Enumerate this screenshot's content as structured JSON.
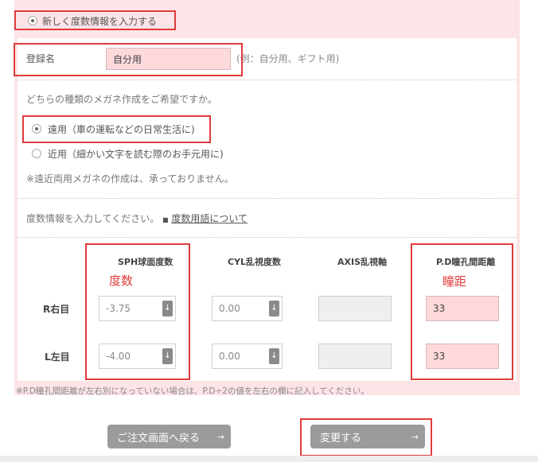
{
  "new_entry": {
    "label": "新しく度数情報を入力する",
    "selected": true
  },
  "registration": {
    "label": "登録名",
    "value": "自分用",
    "hint": "(例：自分用、ギフト用)"
  },
  "glasses_type": {
    "question": "どちらの種類のメガネ作成をご希望ですか。",
    "options": [
      {
        "label": "遠用（車の運転などの日常生活に)",
        "selected": true
      },
      {
        "label": "近用（細かい文字を読む際のお手元用に)",
        "selected": false
      }
    ],
    "note": "※遠近両用メガネの作成は、承っておりません。"
  },
  "prescription": {
    "intro": "度数情報を入力してください。",
    "terms_link": "度数用語について",
    "columns": [
      "SPH球面度数",
      "CYL乱視度数",
      "AXIS乱視軸",
      "P.D瞳孔間距離"
    ],
    "annotations": {
      "sph": "度数",
      "pd": "瞳距"
    },
    "rows": [
      {
        "label": "R右目",
        "sph": "-3.75",
        "cyl": "0.00",
        "axis": "",
        "pd": "33"
      },
      {
        "label": "L左目",
        "sph": "-4.00",
        "cyl": "0.00",
        "axis": "",
        "pd": "33"
      }
    ],
    "stepper_glyph": "↓",
    "footnote": "※P.D瞳孔間距離が左右別になっていない場合は、P.D÷2の値を左右の欄に記入してください。"
  },
  "buttons": {
    "back": "ご注文画面へ戻る",
    "submit": "変更する",
    "arrow": "→"
  },
  "colors": {
    "panel_bg": "#fde4e6",
    "highlight_border": "#e03b3b",
    "button_bg": "#9b9b9b",
    "pink_input": "#fdd9dc"
  }
}
